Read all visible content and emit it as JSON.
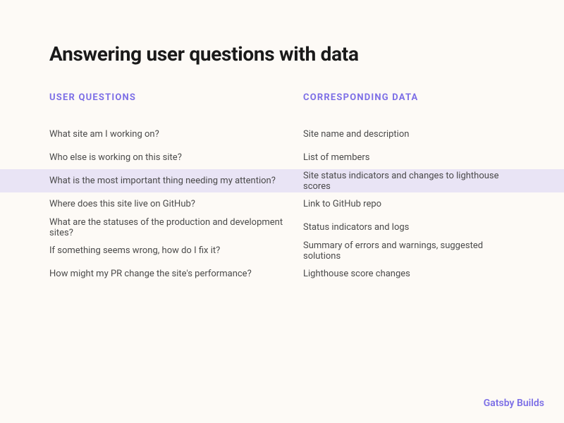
{
  "title": "Answering user questions with data",
  "headers": {
    "left": "USER QUESTIONS",
    "right": "CORRESPONDING DATA"
  },
  "rows": [
    {
      "question": "What site am I working on?",
      "data": "Site name and description",
      "highlighted": false
    },
    {
      "question": "Who else is working on this site?",
      "data": "List of members",
      "highlighted": false
    },
    {
      "question": "What is the most important thing needing my attention?",
      "data": "Site status indicators and changes to lighthouse scores",
      "highlighted": true
    },
    {
      "question": "Where does this site live on GitHub?",
      "data": "Link to GitHub repo",
      "highlighted": false
    },
    {
      "question": "What are the statuses of the production and development sites?",
      "data": "Status indicators and logs",
      "highlighted": false
    },
    {
      "question": "If something seems wrong, how do I fix it?",
      "data": "Summary of errors and warnings, suggested solutions",
      "highlighted": false
    },
    {
      "question": "How might my PR change the site's performance?",
      "data": "Lighthouse score changes",
      "highlighted": false
    }
  ],
  "footer": "Gatsby Builds"
}
